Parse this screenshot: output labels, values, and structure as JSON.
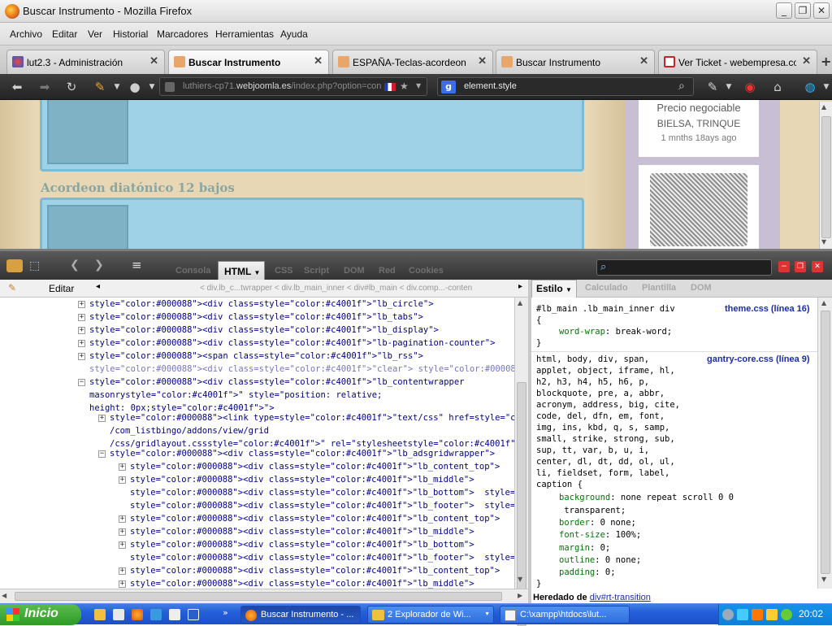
{
  "window": {
    "title": "Buscar Instrumento - Mozilla Firefox"
  },
  "menu": [
    "Archivo",
    "Editar",
    "Ver",
    "Historial",
    "Marcadores",
    "Herramientas",
    "Ayuda"
  ],
  "tabs": [
    {
      "label": "lut2.3 - Administración",
      "active": false
    },
    {
      "label": "Buscar Instrumento",
      "active": true
    },
    {
      "label": "ESPAÑA-Teclas-acordeon",
      "active": false
    },
    {
      "label": "Buscar Instrumento",
      "active": false
    },
    {
      "label": "Ver Ticket - webempresa.com",
      "active": false
    }
  ],
  "navbar": {
    "url_prefix": "luthiers-cp71.",
    "url_domain": "webjoomla.es",
    "url_path": "/index.php?option=con",
    "search_value": "element.style"
  },
  "webpage": {
    "ad_title": "Acordeon diatónico 12 bajos",
    "price": "Precio negociable",
    "location": "BIELSA, TRINQUE",
    "age": "1 mnths 18ays ago"
  },
  "firebug": {
    "tabs": [
      "Consola",
      "HTML",
      "CSS",
      "Script",
      "DOM",
      "Red",
      "Cookies"
    ],
    "active_tab": "HTML",
    "edit_label": "Editar",
    "breadcrumbs": [
      "div.lb_c...twrapper",
      "div.lb_main_inner",
      "div#lb_main",
      "div.comp...-conten"
    ],
    "side_tabs": [
      "Estilo",
      "Calculado",
      "Plantilla",
      "DOM"
    ],
    "active_side_tab": "Estilo"
  },
  "html_lines": [
    {
      "t": "+",
      "html": "<div class=\"lb_circle\">"
    },
    {
      "t": "+",
      "html": "<div class=\"lb_tabs\">"
    },
    {
      "t": "+",
      "html": "<div class=\"lb_display\">"
    },
    {
      "t": "+",
      "html": "<div class=\"lb-pagination-counter\">"
    },
    {
      "t": "+",
      "html": "<span class=\"lb_rss\">"
    },
    {
      "t": "",
      "html": "<div class=\"clear\"> </div>"
    },
    {
      "t": "-",
      "html": "<div class=\"lb_contentwrapper"
    },
    {
      "t": "",
      "html": "masonry\" style=\"position: relative;"
    },
    {
      "t": "",
      "html": "height: 0px;\">"
    },
    {
      "t": "+",
      "html": "<link type=\"text/css\" href=\"/components"
    },
    {
      "t": "",
      "html": "/com_listbingo/addons/view/grid"
    },
    {
      "t": "",
      "html": "/css/gridlayout.css\" rel=\"stylesheet\">"
    },
    {
      "t": "-",
      "html": "<div class=\"lb_adsgridwrapper\">"
    },
    {
      "t": "+",
      "html": "<div class=\"lb_content_top\">"
    },
    {
      "t": "+",
      "html": "<div class=\"lb_middle\">"
    },
    {
      "t": "",
      "html": "<div class=\"lb_bottom\">  </div>"
    },
    {
      "t": "",
      "html": "<div class=\"lb_footer\">  </div>"
    },
    {
      "t": "+",
      "html": "<div class=\"lb_content_top\">"
    },
    {
      "t": "+",
      "html": "<div class=\"lb_middle\">"
    },
    {
      "t": "+",
      "html": "<div class=\"lb_bottom\">"
    },
    {
      "t": "",
      "html": "<div class=\"lb_footer\">  </div>"
    },
    {
      "t": "+",
      "html": "<div class=\"lb_content_top\">"
    },
    {
      "t": "+",
      "html": "<div class=\"lb_middle\">"
    }
  ],
  "css": {
    "rule1_selector": "#lb_main .lb_main_inner div",
    "rule1_source": "theme.css (línea 16)",
    "rule1_decl": "word-wrap: break-word;",
    "rule2_source": "gantry-core.css (línea 9)",
    "rule2_selector_lines": [
      "html, body, div, span,",
      "applet, object, iframe, hl,",
      "h2, h3, h4, h5, h6, p,",
      "blockquote, pre, a, abbr,",
      "acronym, address, big, cite,",
      "code, del, dfn, em, font,",
      "img, ins, kbd, q, s, samp,",
      "small, strike, strong, sub,",
      "sup, tt, var, b, u, i,",
      "center, dl, dt, dd, ol, ul,",
      "li, fieldset, form, label,",
      "caption {"
    ],
    "rule2_decls": [
      {
        "p": "background",
        "v": "none repeat scroll 0 0"
      },
      {
        "p": "",
        "v": " transparent;"
      },
      {
        "p": "border",
        "v": "0 none;"
      },
      {
        "p": "font-size",
        "v": "100%;"
      },
      {
        "p": "margin",
        "v": "0;"
      },
      {
        "p": "outline",
        "v": "0 none;"
      },
      {
        "p": "padding",
        "v": "0;"
      }
    ],
    "inherited_label": "Heredado de",
    "inherited_from": "div#rt-transition"
  },
  "taskbar": {
    "start": "Inicio",
    "tasks": [
      "Buscar Instrumento - ...",
      "2 Explorador de Wi...",
      "C:\\xampp\\htdocs\\lut..."
    ],
    "clock": "20:02"
  }
}
